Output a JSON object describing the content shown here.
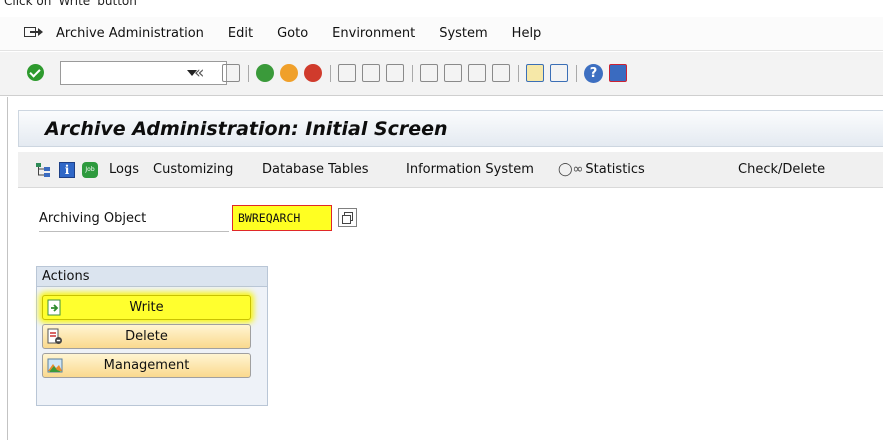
{
  "caption": "Click on 'Write' button",
  "menu": {
    "items": [
      "Archive Administration",
      "Edit",
      "Goto",
      "Environment",
      "System",
      "Help"
    ]
  },
  "toolbar": {
    "command_value": "",
    "back_glyph": "«"
  },
  "page": {
    "title": "Archive Administration: Initial Screen"
  },
  "app_toolbar": {
    "items": [
      "Logs",
      "Customizing",
      "Database Tables",
      "Information System",
      "Statistics",
      "Check/Delete"
    ]
  },
  "form": {
    "archiving_object_label": "Archiving Object",
    "archiving_object_value": "BWREQARCH"
  },
  "actions": {
    "title": "Actions",
    "buttons": [
      "Write",
      "Delete",
      "Management"
    ]
  },
  "colors": {
    "highlight": "#ffff2e",
    "title_bar": "#e4eaf1",
    "actions_panel": "#eef2f8"
  }
}
